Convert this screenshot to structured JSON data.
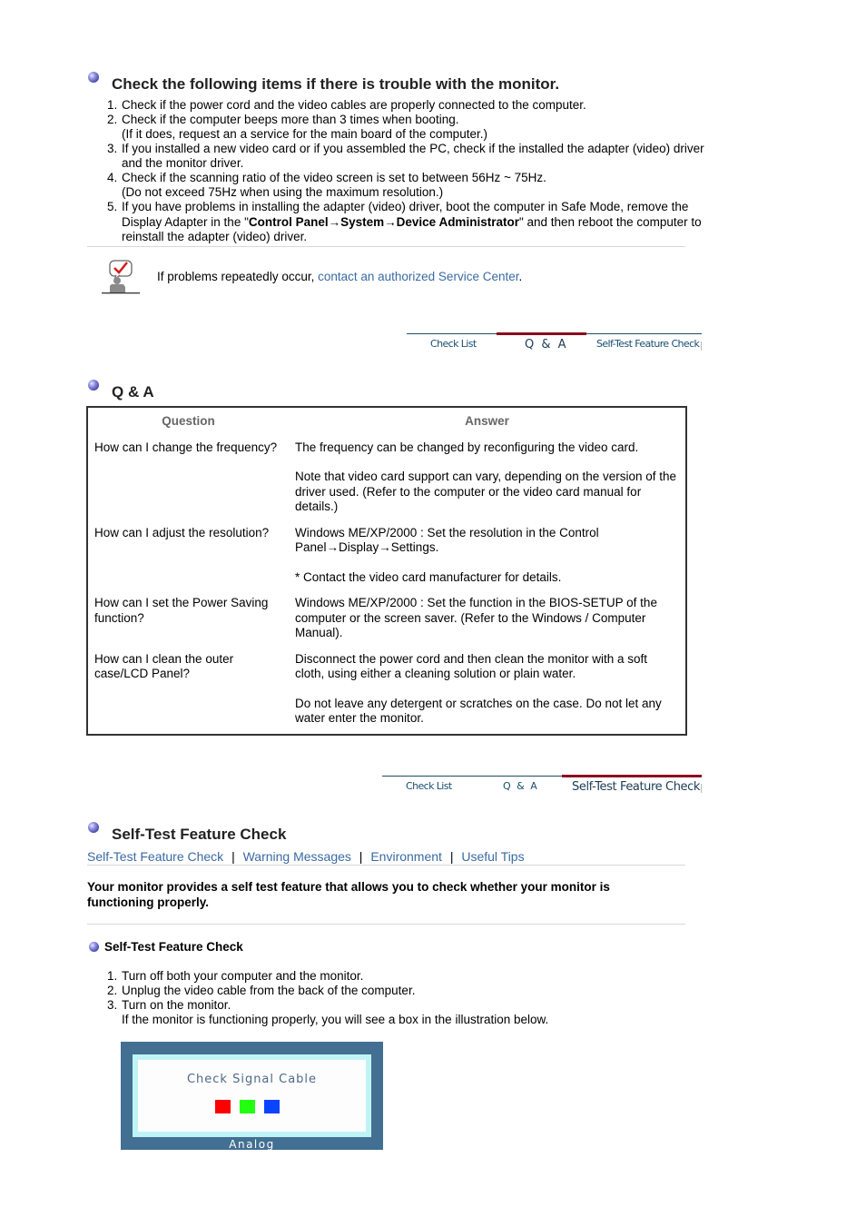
{
  "checklist": {
    "title": "Check the following items if there is trouble with the monitor.",
    "items": [
      {
        "lines": [
          "Check if the power cord and the video cables are properly connected to the computer."
        ]
      },
      {
        "lines": [
          "Check if the computer beeps more than 3 times when booting.",
          "(If it does, request an a service for the main board of the computer.)"
        ]
      },
      {
        "lines": [
          "If you installed a new video card or if you assembled the PC, check if the installed the adapter (video) driver and the monitor driver."
        ]
      },
      {
        "lines": [
          "Check if the scanning ratio of the video screen is set to between 56Hz ~ 75Hz.",
          "(Do not exceed 75Hz when using the maximum resolution.)"
        ]
      }
    ],
    "item5": {
      "pre": "If you have problems in installing the adapter (video) driver, boot the computer in Safe Mode, remove the Display Adapter in the \"",
      "bold": "Control Panel→System→Device Administrator",
      "post": "\" and then reboot the computer to reinstall the adapter (video) driver."
    },
    "note": {
      "icon": "person-checkmark-icon",
      "text": "If problems repeatedly occur, ",
      "link": "contact an authorized Service Center",
      "suffix": "."
    }
  },
  "tabs": {
    "labels": [
      "Check List",
      "Q & A",
      "Self-Test Feature Check"
    ],
    "first_active": 1,
    "second_active": 2,
    "accent_color": "#8c0a1e"
  },
  "qa": {
    "title": "Q & A",
    "headers": [
      "Question",
      "Answer"
    ],
    "rows": [
      {
        "question": "How can I change the frequency?",
        "answers": [
          "The frequency can be changed by reconfiguring the video card.",
          "Note that video card support can vary, depending on the version of the driver used. (Refer to the computer or the video card manual for details.)"
        ]
      },
      {
        "question": "How can I adjust the resolution?",
        "answers": [
          "Windows ME/XP/2000 : Set the resolution in the Control Panel→Display→Settings.",
          "* Contact the video card manufacturer for details."
        ]
      },
      {
        "question": "How can I set the Power Saving function?",
        "answers": [
          "Windows ME/XP/2000 : Set the function in the BIOS-SETUP of the computer or the screen saver. (Refer to the Windows / Computer Manual)."
        ]
      },
      {
        "question": "How can I clean the outer case/LCD Panel?",
        "answers": [
          "Disconnect the power cord and then clean the monitor with a soft cloth, using either a cleaning solution or plain water.",
          "Do not leave any detergent or scratches on the case. Do not let any water enter the monitor."
        ]
      }
    ]
  },
  "selftest": {
    "title": "Self-Test Feature Check",
    "links": [
      "Self-Test Feature Check",
      "Warning Messages",
      "Environment",
      "Useful Tips"
    ],
    "separator": "|",
    "intro": "Your monitor provides a self test feature that allows you to check whether your monitor is functioning properly.",
    "subtitle": "Self-Test Feature Check",
    "steps": [
      {
        "lines": [
          "Turn off both your computer and the monitor."
        ]
      },
      {
        "lines": [
          "Unplug the video cable from the back of the computer."
        ]
      },
      {
        "lines": [
          "Turn on the monitor.",
          "If the monitor is functioning properly, you will see a box in the illustration below."
        ]
      }
    ],
    "illustration": {
      "message": "Check Signal Cable",
      "footer": "Analog",
      "squares": [
        "#ff0000",
        "#22ff11",
        "#0a44ff"
      ]
    }
  }
}
